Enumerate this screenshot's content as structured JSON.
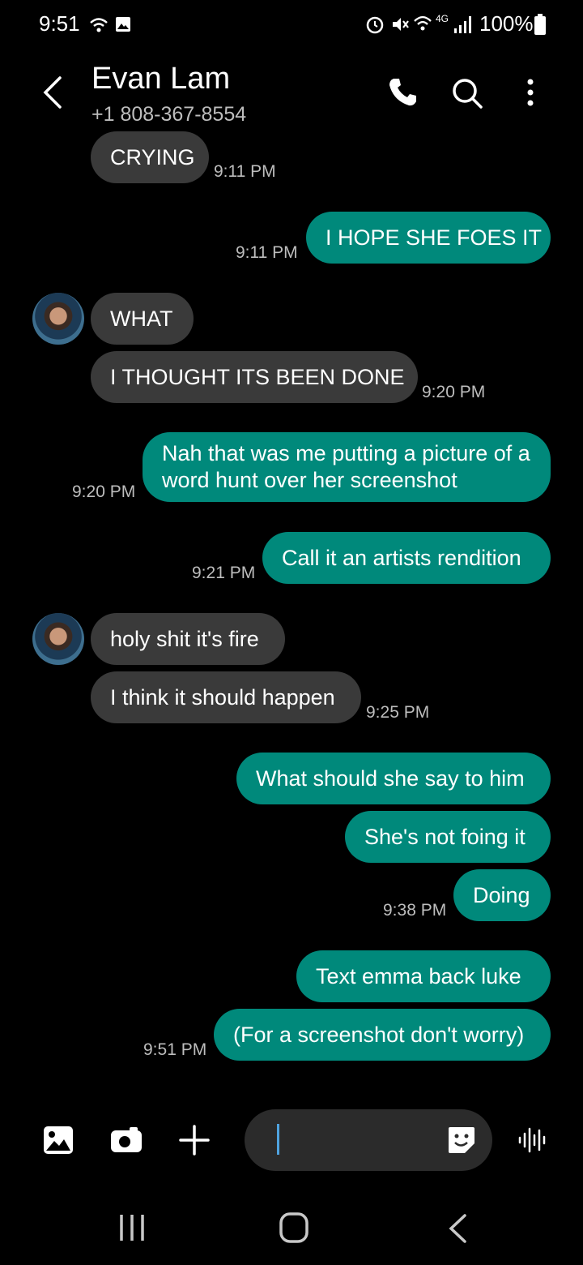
{
  "status_bar": {
    "time": "9:51",
    "battery": "100%",
    "network": "4G"
  },
  "header": {
    "contact_name": "Evan Lam",
    "phone": "+1 808-367-8554"
  },
  "messages": [
    {
      "dir": "in",
      "text": "CRYING",
      "time": "9:11 PM"
    },
    {
      "dir": "out",
      "text": "I HOPE SHE FOES IT",
      "time": "9:11 PM"
    },
    {
      "dir": "in",
      "text": "WHAT",
      "time": ""
    },
    {
      "dir": "in",
      "text": "I THOUGHT ITS BEEN DONE",
      "time": "9:20 PM"
    },
    {
      "dir": "out",
      "text": "Nah that was me putting a picture of a word hunt over her screenshot",
      "time": "9:20 PM"
    },
    {
      "dir": "out",
      "text": "Call it an artists rendition",
      "time": "9:21 PM"
    },
    {
      "dir": "in",
      "text": "holy shit it's fire",
      "time": ""
    },
    {
      "dir": "in",
      "text": "I think it should happen",
      "time": "9:25 PM"
    },
    {
      "dir": "out",
      "text": "What should she say to him",
      "time": ""
    },
    {
      "dir": "out",
      "text": "She's not foing it",
      "time": ""
    },
    {
      "dir": "out",
      "text": "Doing",
      "time": "9:38 PM"
    },
    {
      "dir": "out",
      "text": "Text emma back luke",
      "time": ""
    },
    {
      "dir": "out",
      "text": "(For a screenshot don't worry)",
      "time": "9:51 PM"
    }
  ],
  "composer": {
    "value": ""
  },
  "colors": {
    "outgoing": "#00897b",
    "incoming": "#3a3a3a",
    "background": "#000000"
  }
}
